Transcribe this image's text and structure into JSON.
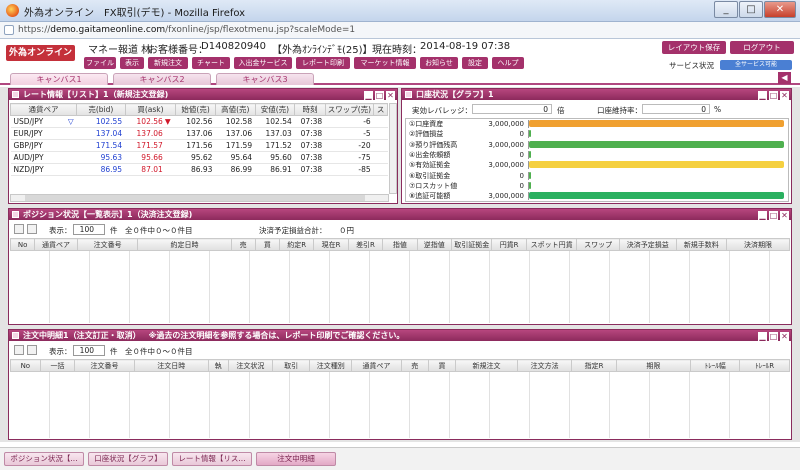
{
  "window": {
    "title": "外為オンライン　FX取引(デモ) - Mozilla Firefox",
    "url_host": "demo.gaitameonline.com",
    "url_rest": "/fxonline/jsp/flexotmenu.jsp?scaleMode=1",
    "url_scheme": "https://"
  },
  "header": {
    "logo": "外為オンライン",
    "account_label": "マネー報道 林",
    "customer_label": "お客様番号：",
    "customer_no": "D140820940",
    "demo_tag": "【外為ｵﾝﾗｲﾝﾃﾞﾓ(25)】",
    "time_label": "現在時刻：",
    "time": "2014-08-19 07:38",
    "layout_save": "レイアウト保存",
    "logout": "ログアウト",
    "service_status": "サービス状況",
    "service_badge": "全サービス可能"
  },
  "menu": [
    "ファイル",
    "表示",
    "新規注文",
    "チャート",
    "入出金サービス",
    "レポート印刷",
    "マーケット情報",
    "お知らせ",
    "設定",
    "ヘルプ"
  ],
  "canvas_tabs": [
    "キャンバス1",
    "キャンバス2",
    "キャンバス3"
  ],
  "rate_panel": {
    "title": "レート情報【リスト】1（新規注文登録)",
    "headers": [
      "通貨ペア",
      "売(bid)",
      "買(ask)",
      "始値(売)",
      "高値(売)",
      "安値(売)",
      "時刻",
      "スワップ(売)",
      "ス"
    ],
    "rows": [
      {
        "pair": "USD/JPY",
        "bid": "102.55",
        "ask": "102.56",
        "open": "102.56",
        "high": "102.58",
        "low": "102.54",
        "time": "07:38",
        "swap": "-6",
        "bid_color": "#1f3fd1",
        "ask_color": "#d1182a",
        "arrow": "▽",
        "arrow2": "▼"
      },
      {
        "pair": "EUR/JPY",
        "bid": "137.04",
        "ask": "137.06",
        "open": "137.06",
        "high": "137.06",
        "low": "137.03",
        "time": "07:38",
        "swap": "-5",
        "bid_color": "#1f3fd1",
        "ask_color": "#d1182a",
        "arrow": "",
        "arrow2": ""
      },
      {
        "pair": "GBP/JPY",
        "bid": "171.54",
        "ask": "171.57",
        "open": "171.56",
        "high": "171.59",
        "low": "171.52",
        "time": "07:38",
        "swap": "-20",
        "bid_color": "#1f3fd1",
        "ask_color": "#d1182a",
        "arrow": "",
        "arrow2": ""
      },
      {
        "pair": "AUD/JPY",
        "bid": "95.63",
        "ask": "95.66",
        "open": "95.62",
        "high": "95.64",
        "low": "95.60",
        "time": "07:38",
        "swap": "-75",
        "bid_color": "#1f3fd1",
        "ask_color": "#d1182a",
        "arrow": "",
        "arrow2": ""
      },
      {
        "pair": "NZD/JPY",
        "bid": "86.95",
        "ask": "87.01",
        "open": "86.93",
        "high": "86.99",
        "low": "86.91",
        "time": "07:38",
        "swap": "-85",
        "bid_color": "#1f3fd1",
        "ask_color": "#d1182a",
        "arrow": "",
        "arrow2": ""
      }
    ]
  },
  "account_panel": {
    "title": "口座状況【グラフ】1",
    "leverage_label": "実効レバレッジ：",
    "leverage_value": "0",
    "leverage_unit": "倍",
    "margin_label": "口座維持率：",
    "margin_value": "0",
    "margin_unit": "%",
    "items": [
      {
        "label": "①口座資産",
        "value": "3,000,000",
        "color": "#f0a030",
        "level": 1.0
      },
      {
        "label": "②評価損益",
        "value": "0",
        "color": "#4fb04f",
        "level": 0.0
      },
      {
        "label": "③預り評価残高",
        "value": "3,000,000",
        "color": "#4fb04f",
        "level": 1.0
      },
      {
        "label": "④出金依頼額",
        "value": "0",
        "color": "#4fb04f",
        "level": 0.0
      },
      {
        "label": "⑤有効証拠金",
        "value": "3,000,000",
        "color": "#f5d040",
        "level": 1.0
      },
      {
        "label": "⑥取引証拠金",
        "value": "0",
        "color": "#4fb04f",
        "level": 0.0
      },
      {
        "label": "⑦ロスカット値",
        "value": "0",
        "color": "#4fb04f",
        "level": 0.0
      },
      {
        "label": "⑧追証可能額",
        "value": "3,000,000",
        "color": "#2ab060",
        "level": 1.0
      }
    ]
  },
  "position_panel": {
    "title": "ポジション状況【一覧表示】1（決済注文登録)",
    "display_label": "表示：",
    "display_value": "100",
    "count_unit": "件",
    "count_text": "全０件中０～０件目",
    "pending_label": "決済予定損益合計：",
    "pending_value": "０円",
    "headers": [
      "No",
      "通貨ペア",
      "注文番号",
      "約定日時",
      "売",
      "買",
      "約定R",
      "現在R",
      "差引R",
      "指値",
      "逆指値",
      "取引証拠金",
      "円貨R",
      "スポット円貨",
      "スワップ",
      "決済予定損益",
      "新規手数料",
      "決済期限"
    ]
  },
  "order_panel": {
    "title": "注文中明細1（注文訂正・取消）",
    "notice": "※過去の注文明細を参照する場合は、レポート印刷でご確認ください。",
    "display_label": "表示：",
    "display_value": "100",
    "count_unit": "件",
    "count_text": "全０件中０～０件目",
    "headers": [
      "No",
      "一括",
      "注文番号",
      "注文日時",
      "執",
      "注文状況",
      "取引",
      "注文種別",
      "通貨ペア",
      "売",
      "買",
      "新規注文",
      "注文方法",
      "指定R",
      "期限",
      "ﾄﾚｰﾙ幅",
      "ﾄﾚｰﾙR"
    ]
  },
  "taskbar": [
    "ポジション状況【...",
    "口座状況【グラフ】",
    "レート情報【リス...",
    "注文中明細"
  ]
}
